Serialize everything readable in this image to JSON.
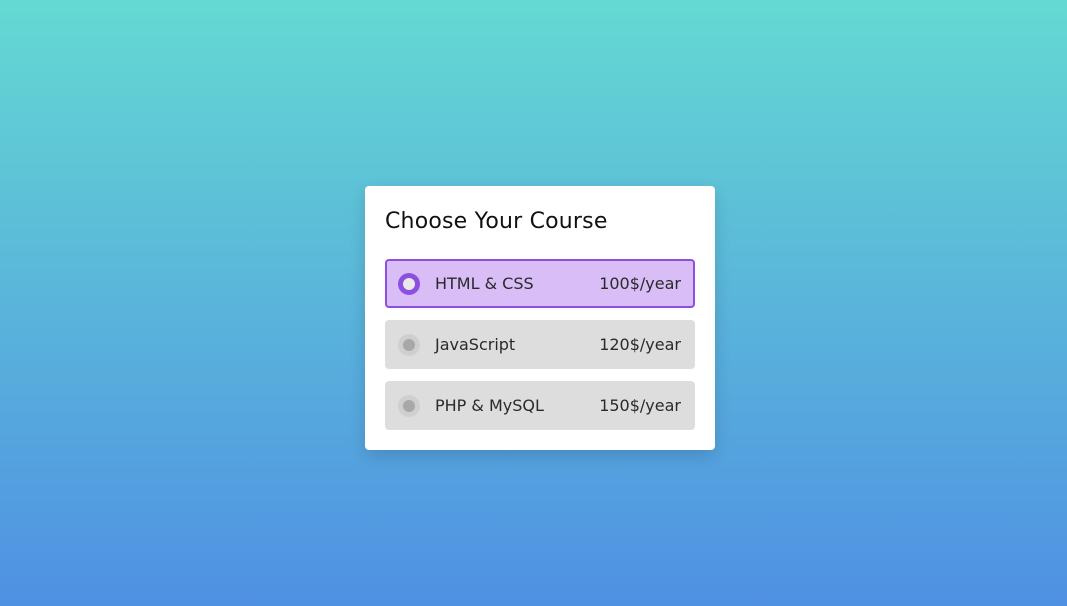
{
  "page": {
    "title": "Choose Your Course"
  },
  "courses": [
    {
      "label": "HTML & CSS",
      "price": "100$/year",
      "selected": true
    },
    {
      "label": "JavaScript",
      "price": "120$/year",
      "selected": false
    },
    {
      "label": "PHP & MySQL",
      "price": "150$/year",
      "selected": false
    }
  ],
  "colors": {
    "accent": "#8c4fe0",
    "selected_background": "#d8bdf7",
    "option_background": "#dddddd"
  }
}
